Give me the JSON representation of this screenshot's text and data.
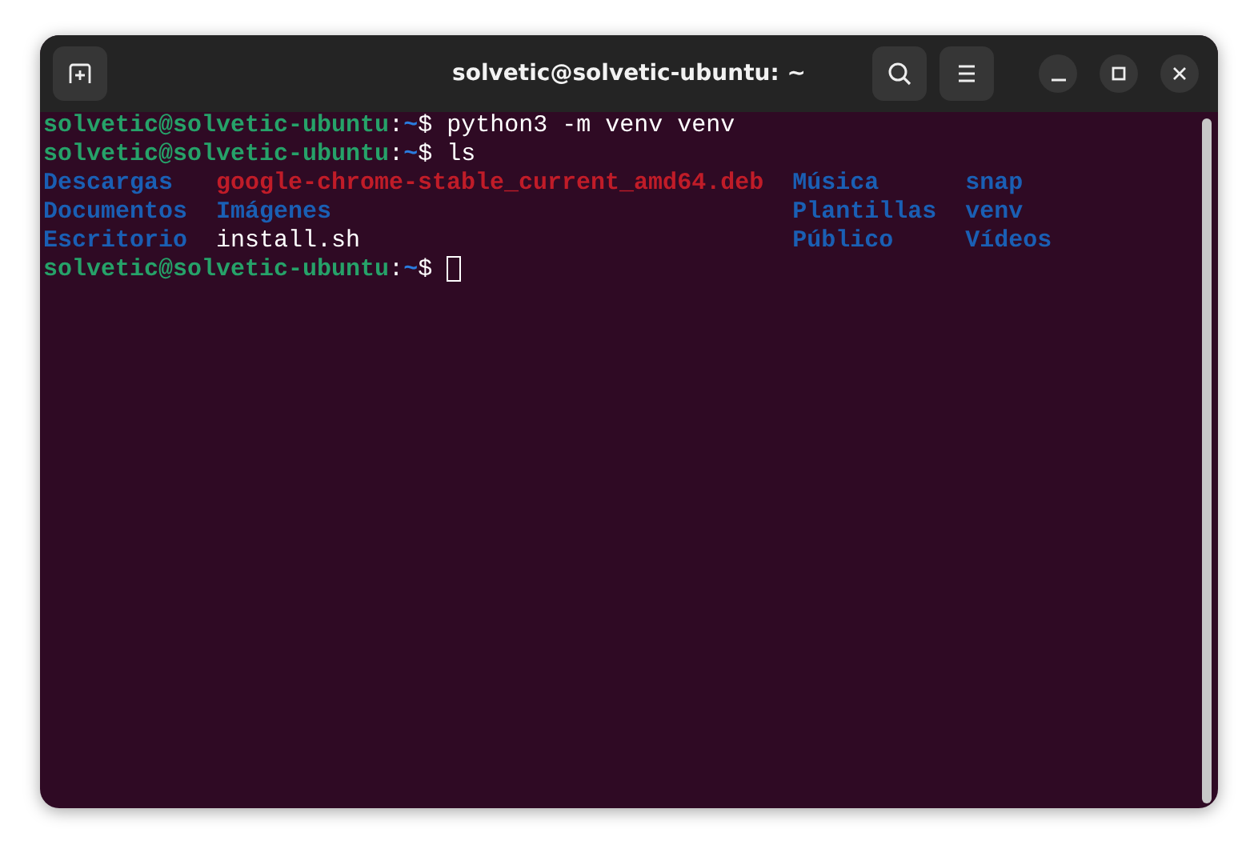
{
  "window": {
    "title": "solvetic@solvetic-ubuntu: ~"
  },
  "terminal": {
    "lines": [
      {
        "kind": "prompt",
        "user_host": "solvetic@solvetic-ubuntu",
        "separator": ":",
        "path": "~",
        "symbol": "$",
        "command": "python3 -m venv venv"
      },
      {
        "kind": "prompt",
        "user_host": "solvetic@solvetic-ubuntu",
        "separator": ":",
        "path": "~",
        "symbol": "$",
        "command": "ls"
      },
      {
        "kind": "listing",
        "columns": [
          [
            {
              "name": "Descargas",
              "kind": "dir"
            },
            {
              "name": "Documentos",
              "kind": "dir"
            },
            {
              "name": "Escritorio",
              "kind": "dir"
            }
          ],
          [
            {
              "name": "google-chrome-stable_current_amd64.deb",
              "kind": "archive"
            },
            {
              "name": "Imágenes",
              "kind": "dir"
            },
            {
              "name": "install.sh",
              "kind": "file"
            }
          ],
          [
            {
              "name": "Música",
              "kind": "dir"
            },
            {
              "name": "Plantillas",
              "kind": "dir"
            },
            {
              "name": "Público",
              "kind": "dir"
            }
          ],
          [
            {
              "name": "snap",
              "kind": "dir"
            },
            {
              "name": "venv",
              "kind": "dir"
            },
            {
              "name": "Vídeos",
              "kind": "dir"
            }
          ]
        ]
      },
      {
        "kind": "prompt",
        "user_host": "solvetic@solvetic-ubuntu",
        "separator": ":",
        "path": "~",
        "symbol": "$",
        "cursor": true
      }
    ]
  }
}
